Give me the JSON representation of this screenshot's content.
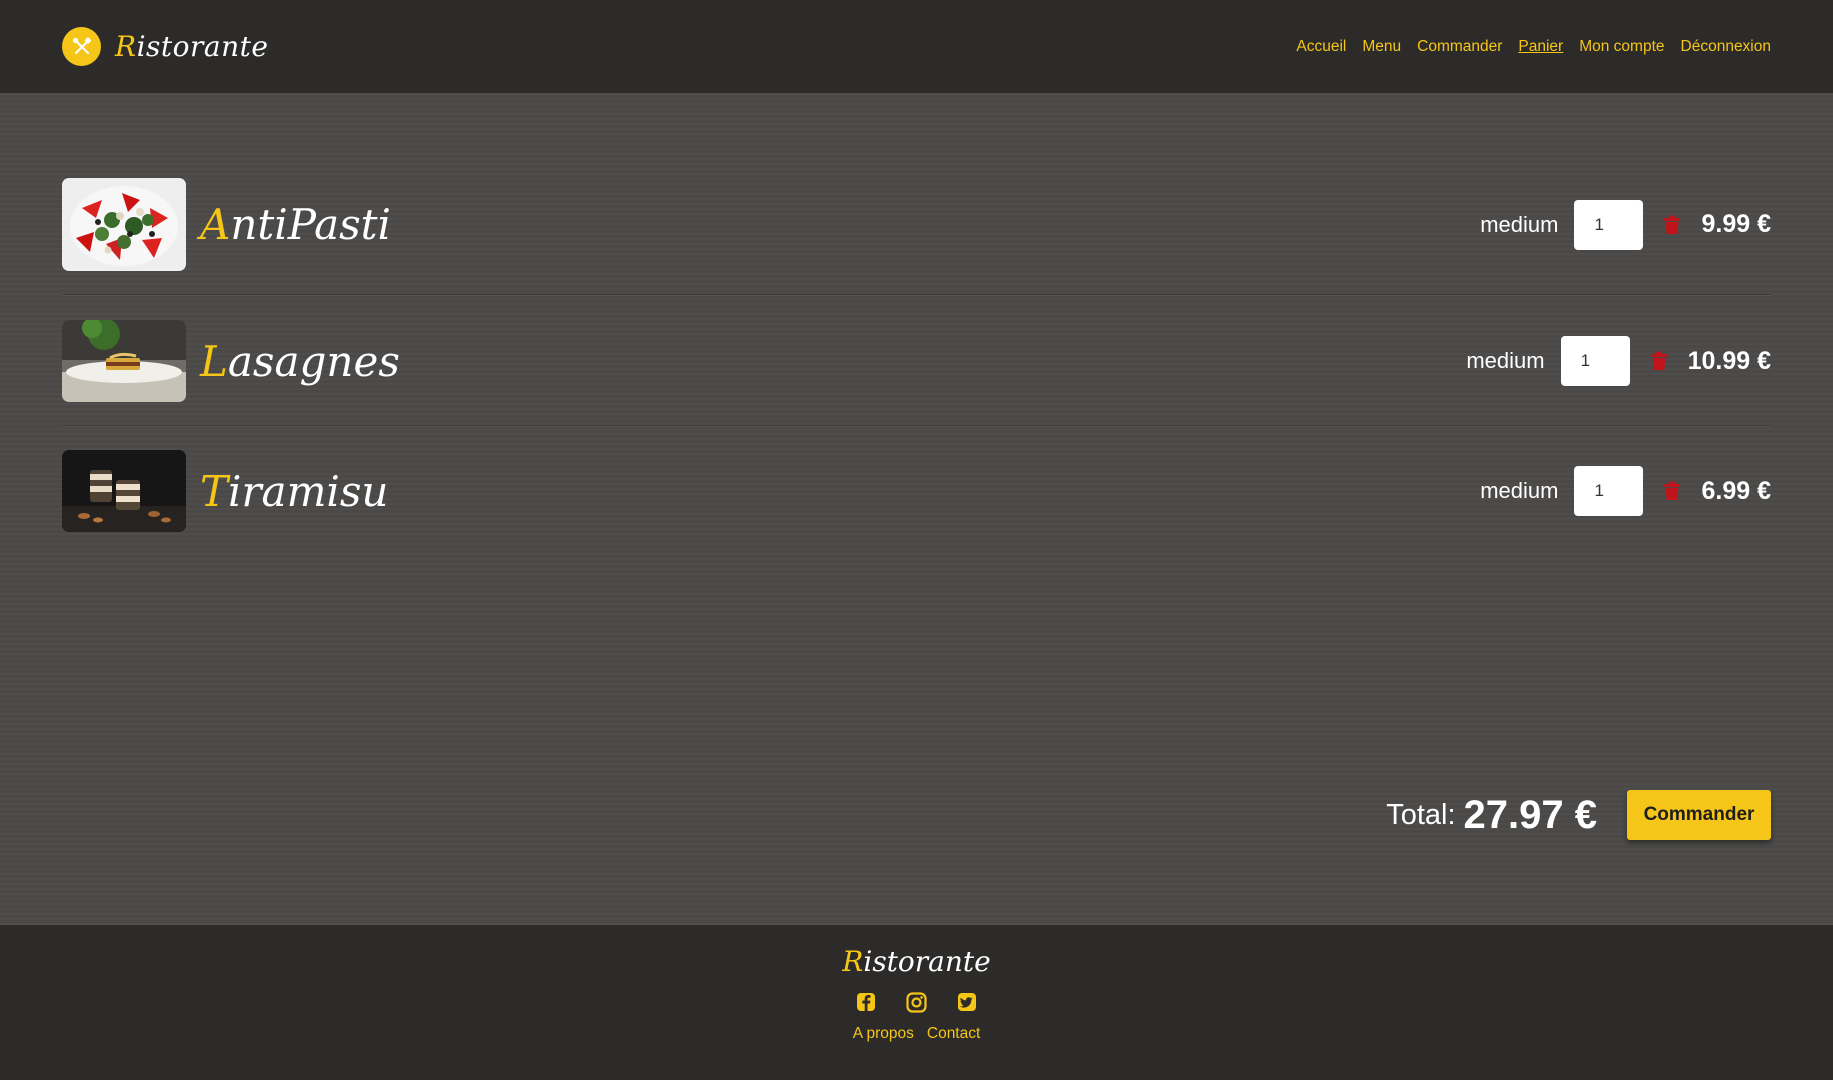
{
  "header": {
    "brand_initial": "R",
    "brand_rest": "istorante",
    "nav": [
      {
        "label": "Accueil"
      },
      {
        "label": "Menu"
      },
      {
        "label": "Commander"
      },
      {
        "label": "Panier",
        "active": true
      },
      {
        "label": "Mon compte"
      },
      {
        "label": "Déconnexion"
      }
    ]
  },
  "cart": {
    "items": [
      {
        "name_initial": "A",
        "name_rest": "ntiPasti",
        "size": "medium",
        "quantity": "1",
        "price": "9.99 €",
        "image": "antipasti-salad-photo"
      },
      {
        "name_initial": "L",
        "name_rest": "asagnes",
        "size": "medium",
        "quantity": "1",
        "price": "10.99 €",
        "image": "lasagnes-plate-photo"
      },
      {
        "name_initial": "T",
        "name_rest": "iramisu",
        "size": "medium",
        "quantity": "1",
        "price": "6.99 €",
        "image": "tiramisu-glasses-photo"
      }
    ],
    "total_label": "Total:",
    "total_value": "27.97 €",
    "order_button": "Commander"
  },
  "footer": {
    "brand_initial": "R",
    "brand_rest": "istorante",
    "socials": [
      "facebook-icon",
      "instagram-icon",
      "twitter-icon"
    ],
    "links": [
      {
        "label": "A propos"
      },
      {
        "label": "Contact"
      }
    ]
  },
  "colors": {
    "accent": "#f5c518",
    "header_bg": "#2c2b2a",
    "page_bg": "#4b4a49",
    "trash": "#c0141a"
  }
}
